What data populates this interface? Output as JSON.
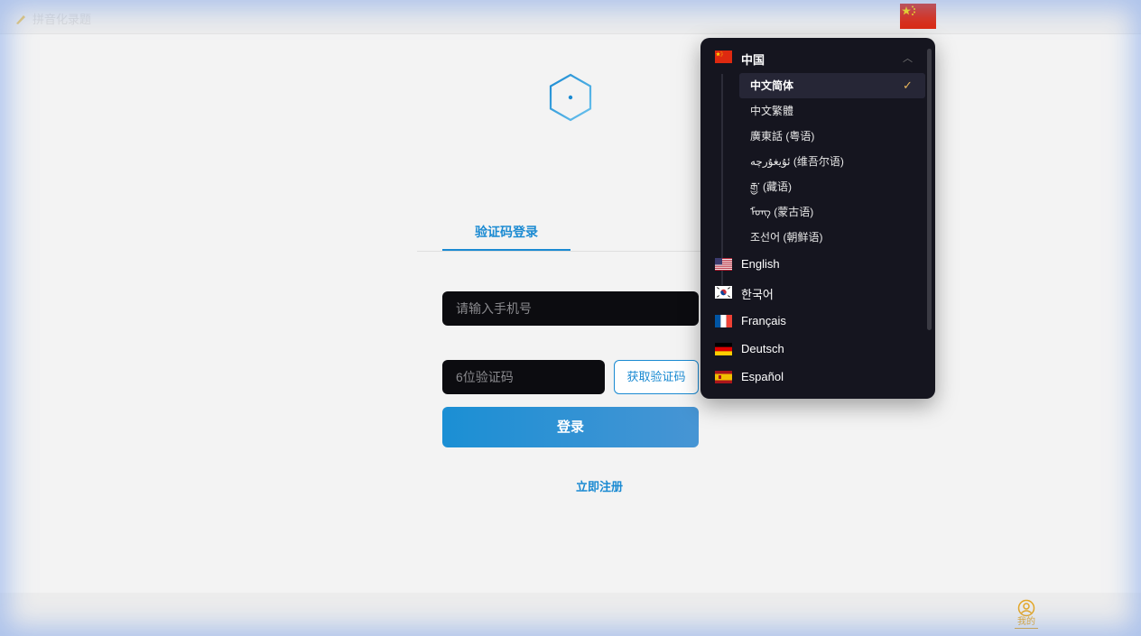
{
  "app": {
    "title": "拼音化录题"
  },
  "auth": {
    "tab_label": "验证码登录",
    "phone_placeholder": "请输入手机号",
    "code_placeholder": "6位验证码",
    "get_code_label": "获取验证码",
    "login_label": "登录",
    "register_label": "立即注册"
  },
  "bottom_nav": {
    "mine_label": "我的"
  },
  "language_menu": {
    "region": {
      "name": "中国",
      "flag": "cn-flag-icon"
    },
    "sub_languages": [
      {
        "label": "中文简体",
        "selected": true
      },
      {
        "label": "中文繁體",
        "selected": false
      },
      {
        "label": "廣東話 (粤语)",
        "selected": false
      },
      {
        "label": "ئۇيغۇرچە (维吾尔语)",
        "selected": false
      },
      {
        "label": "རྒྱ་ (藏语)",
        "selected": false
      },
      {
        "label": "ᠮᠣᠩ (蒙古语)",
        "selected": false
      },
      {
        "label": "조선어 (朝鲜语)",
        "selected": false
      }
    ],
    "languages": [
      {
        "label": "English",
        "flag": "us-flag-icon"
      },
      {
        "label": "한국어",
        "flag": "kr-flag-icon"
      },
      {
        "label": "Français",
        "flag": "fr-flag-icon"
      },
      {
        "label": "Deutsch",
        "flag": "de-flag-icon"
      },
      {
        "label": "Español",
        "flag": "es-flag-icon"
      }
    ],
    "check_mark": "✓",
    "caret": "︿"
  },
  "colors": {
    "accent": "#1a8ad2",
    "gold": "#e5a623",
    "dropdown_bg": "#15151f"
  }
}
